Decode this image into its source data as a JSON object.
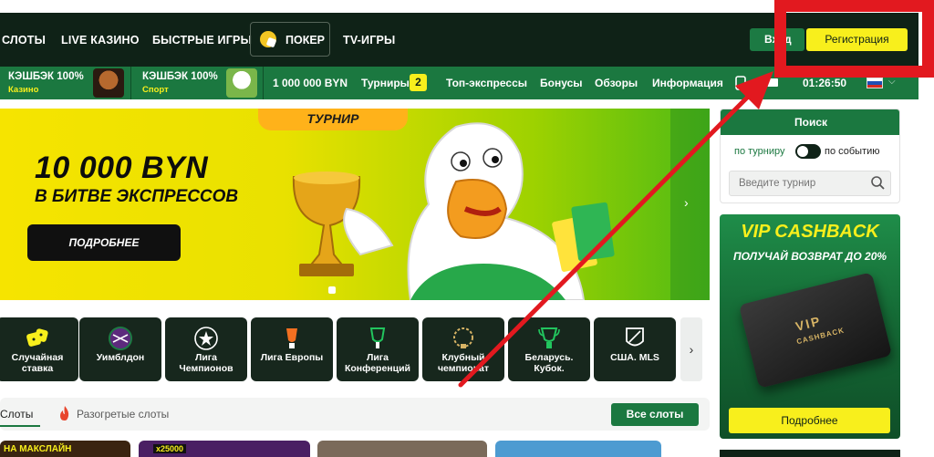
{
  "header": {
    "nav": [
      "СЛОТЫ",
      "LIVE КАЗИНО",
      "БЫСТРЫЕ ИГРЫ",
      "ПОКЕР",
      "TV-ИГРЫ"
    ],
    "login_label": "Вход",
    "register_label": "Регистрация"
  },
  "subbar": {
    "cashback_casino_title": "КЭШБЭК 100%",
    "cashback_casino_sub": "Казино",
    "cashback_sport_title": "КЭШБЭК 100%",
    "cashback_sport_sub": "Спорт",
    "items": [
      "1 000 000 BYN",
      "Турниры",
      "Топ-экспрессы",
      "Бонусы",
      "Обзоры",
      "Информация"
    ],
    "tournaments_count": "2",
    "time": "01:26:50"
  },
  "banner": {
    "tab": "ТУРНИР",
    "amount": "10 000 BYN",
    "subtitle": "В БИТВЕ ЭКСПРЕССОВ",
    "button": "ПОДРОБНЕЕ"
  },
  "categories": [
    {
      "label": "Случайная ставка",
      "icon": "dice-icon"
    },
    {
      "label": "Уимблдон",
      "icon": "wimbledon-icon"
    },
    {
      "label": "Лига Чемпионов",
      "icon": "champions-league-icon"
    },
    {
      "label": "Лига Европы",
      "icon": "europa-league-icon"
    },
    {
      "label": "Лига Конференций",
      "icon": "conference-league-icon"
    },
    {
      "label": "Клубный чемпионат",
      "icon": "club-world-cup-icon"
    },
    {
      "label": "Беларусь. Кубок.",
      "icon": "cup-icon"
    },
    {
      "label": "США. MLS",
      "icon": "mls-icon"
    }
  ],
  "slots": {
    "tab_active": "Слоты",
    "tab_hot": "Разогретые слоты",
    "all_button": "Все слоты",
    "thumb_text_1": "НА МАКСЛАЙН",
    "thumb_text_2": "x25000"
  },
  "search": {
    "title": "Поиск",
    "option_tournament": "по турниру",
    "option_event": "по событию",
    "placeholder": "Введите турнир"
  },
  "vip": {
    "title": "VIP CASHBACK",
    "subtitle": "ПОЛУЧАЙ ВОЗВРАТ ДО 20%",
    "card_title": "VIP",
    "card_sub": "CASHBACK",
    "button": "Подробнее"
  },
  "colors": {
    "dark": "#0f2217",
    "green": "#1b7840",
    "yellow": "#f8ef1c",
    "annotation_red": "#e2191f"
  }
}
